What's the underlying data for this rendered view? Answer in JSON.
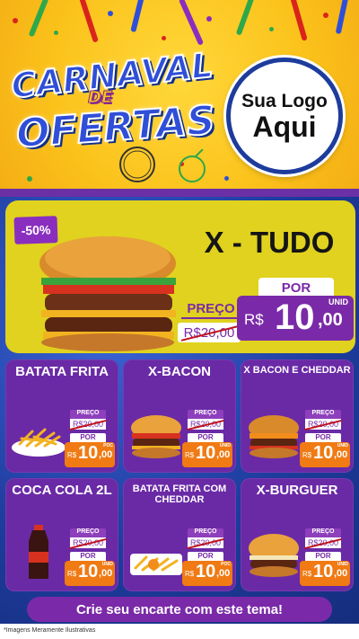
{
  "header": {
    "title_line1": "CARNAVAL",
    "title_line2": "DE",
    "title_line3": "OFERTAS",
    "logo_line1": "Sua Logo",
    "logo_line2": "Aqui"
  },
  "featured": {
    "name": "X - TUDO",
    "discount": "-50%",
    "preco_label": "PREÇO",
    "old_price": "R$20,00",
    "por_label": "POR",
    "currency": "R$",
    "price_int": "10",
    "price_cents": ",00",
    "unit": "UNID"
  },
  "cards": [
    {
      "name": "BATATA FRITA",
      "preco_label": "PREÇO",
      "old_price": "R$20,00",
      "por_label": "POR",
      "currency": "R$",
      "price_int": "10",
      "price_cents": ",00",
      "unit": "POC"
    },
    {
      "name": "X-BACON",
      "preco_label": "PREÇO",
      "old_price": "R$20,00",
      "por_label": "POR",
      "currency": "R$",
      "price_int": "10",
      "price_cents": ",00",
      "unit": "UNID"
    },
    {
      "name": "X BACON E CHEDDAR",
      "preco_label": "PREÇO",
      "old_price": "R$20,00",
      "por_label": "POR",
      "currency": "R$",
      "price_int": "10",
      "price_cents": ",00",
      "unit": "UNID"
    },
    {
      "name": "COCA COLA 2L",
      "preco_label": "PREÇO",
      "old_price": "R$20,00",
      "por_label": "POR",
      "currency": "R$",
      "price_int": "10",
      "price_cents": ",00",
      "unit": "UNID"
    },
    {
      "name": "BATATA FRITA COM CHEDDAR",
      "preco_label": "PREÇO",
      "old_price": "R$20,00",
      "por_label": "POR",
      "currency": "R$",
      "price_int": "10",
      "price_cents": ",00",
      "unit": "POC"
    },
    {
      "name": "X-BURGUER",
      "preco_label": "PREÇO",
      "old_price": "R$20,00",
      "por_label": "POR",
      "currency": "R$",
      "price_int": "10",
      "price_cents": ",00",
      "unit": "UNID"
    }
  ],
  "footer": {
    "cta": "Crie seu encarte com este tema!",
    "disclaimer": "*Imagens Meramente Ilustrativas"
  },
  "colors": {
    "purple": "#6a2aa6",
    "yellow": "#e0d21e",
    "orange": "#f07a13",
    "blue": "#1e3c9d"
  }
}
